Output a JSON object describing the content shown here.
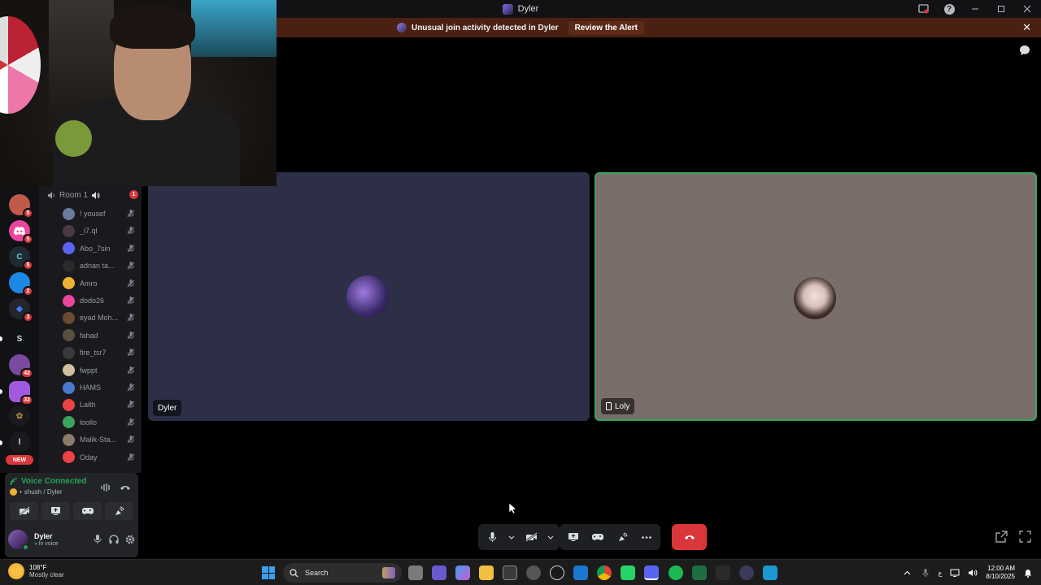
{
  "window": {
    "title": "Dyler"
  },
  "alert": {
    "message": "Unusual join activity detected in Dyler",
    "action_label": "Review the Alert"
  },
  "servers": [
    {
      "icon": "avatar",
      "color": "#c25a4a",
      "badge": "5"
    },
    {
      "icon": "discord-icon",
      "color": "#eb459e",
      "badge": "5"
    },
    {
      "icon": "c-logo",
      "color": "#1f2a33",
      "badge": "5"
    },
    {
      "icon": "cube-logo",
      "color": "#1e88e5",
      "badge": "2"
    },
    {
      "icon": "diamond-logo",
      "color": "#23262d",
      "badge": "3"
    },
    {
      "icon": "s-logo",
      "color": "#0f1316",
      "label": "S",
      "badge": ""
    },
    {
      "icon": "group-avatar",
      "color": "#7a4aa0",
      "badge": "42"
    },
    {
      "icon": "gradient-logo",
      "color": "#a05ae0",
      "badge": "32"
    },
    {
      "icon": "plant-logo",
      "color": "#1a1a1e",
      "badge": ""
    },
    {
      "icon": "l-logo",
      "color": "#1a1a1e",
      "label": "l",
      "badge": ""
    }
  ],
  "new_label": "NEW",
  "channel": {
    "room_name": "Room 1",
    "room_badge": "1",
    "members": [
      {
        "name": "! yousef",
        "color": "#6a7aa0"
      },
      {
        "name": "_i7.ql",
        "color": "#4a3a40"
      },
      {
        "name": "Abo_7sin",
        "color": "#5865f2"
      },
      {
        "name": "adnan ta...",
        "color": "#2a2a2a"
      },
      {
        "name": "Amro",
        "color": "#f0b232"
      },
      {
        "name": "dodo26",
        "color": "#eb459e"
      },
      {
        "name": "eyad Moh...",
        "color": "#6a4a30"
      },
      {
        "name": "fahad",
        "color": "#5a5040"
      },
      {
        "name": "fire_tsr7",
        "color": "#3a3a3a"
      },
      {
        "name": "fwppt",
        "color": "#d0c0a0"
      },
      {
        "name": "HAMS",
        "color": "#4a7ad0"
      },
      {
        "name": "Laith",
        "color": "#ed4245"
      },
      {
        "name": "loollo",
        "color": "#3ba55c"
      },
      {
        "name": "Malik-Sta...",
        "color": "#8a7a6a"
      },
      {
        "name": "Oday",
        "color": "#ed4245"
      }
    ]
  },
  "voice": {
    "status": "Voice Connected",
    "location": "shush / Dyler"
  },
  "user": {
    "name": "Dyler",
    "status": "In voice"
  },
  "tiles": [
    {
      "name": "Dyler",
      "bg": "#2c2f45"
    },
    {
      "name": "Loly",
      "bg": "#7a6e6b",
      "speaking": true
    }
  ],
  "taskbar": {
    "weather_temp": "108°F",
    "weather_desc": "Mostly clear",
    "search_label": "Search",
    "tray_lang": "ع",
    "time": "12:00 AM",
    "date": "8/10/2025"
  }
}
